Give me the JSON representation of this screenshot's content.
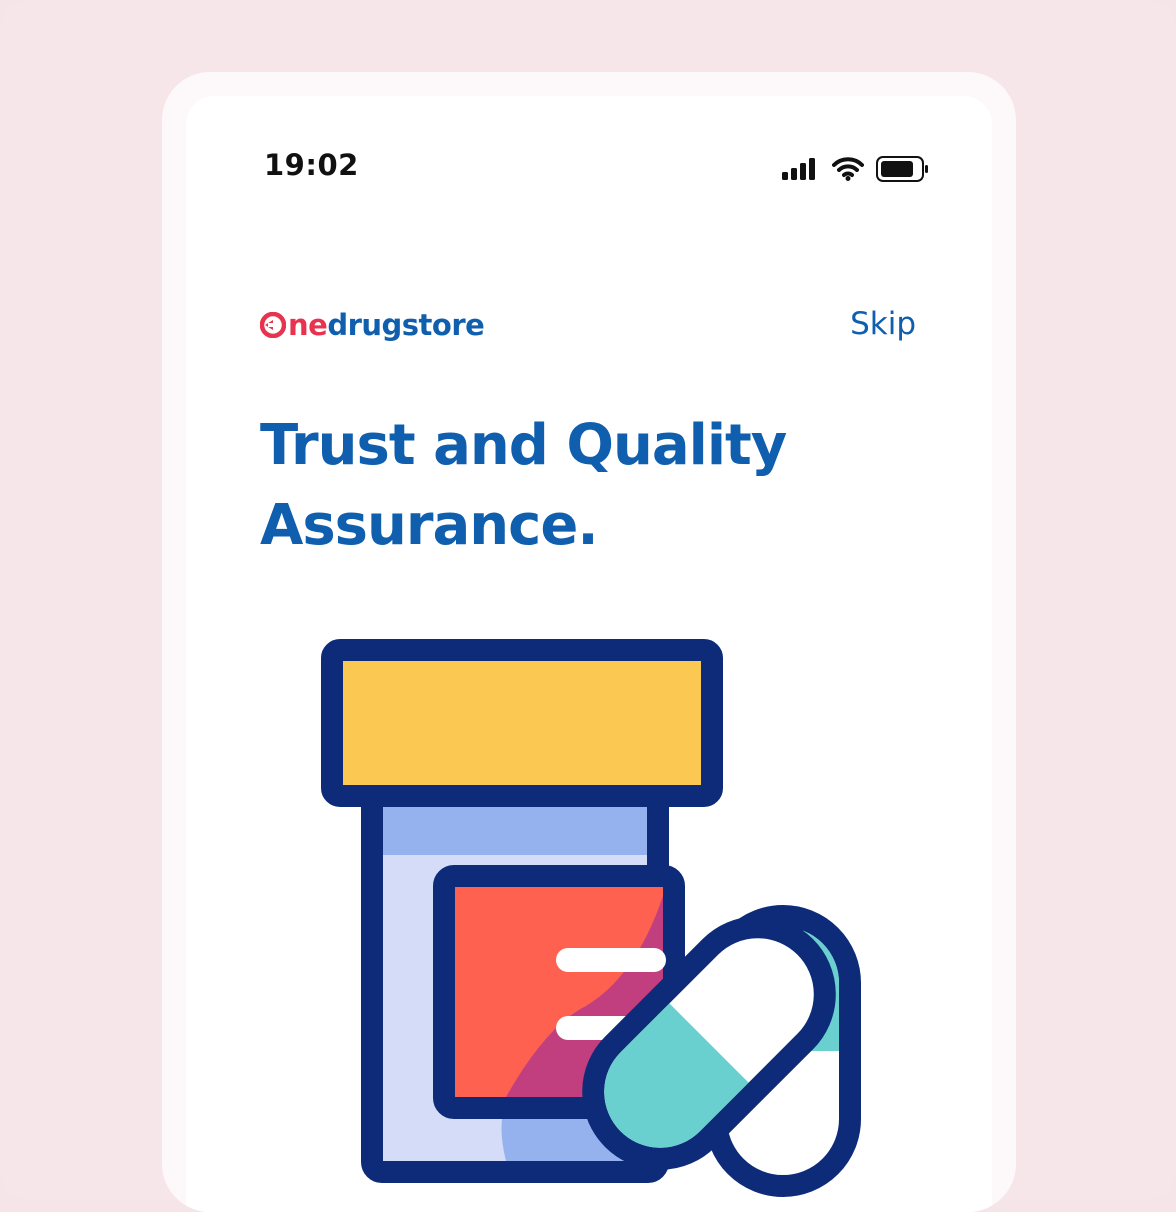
{
  "status_bar": {
    "time": "19:02"
  },
  "brand": {
    "logo_prefix": "ne",
    "logo_suffix": "drugstore"
  },
  "header": {
    "skip_label": "Skip"
  },
  "onboarding": {
    "title_line1": "Trust and Quality",
    "title_line2": "Assurance."
  },
  "colors": {
    "brand_blue": "#0f5fae",
    "brand_red": "#e8334f",
    "outline_navy": "#0d2b78",
    "cap_yellow": "#fbc952",
    "label_red": "#fe6150",
    "capsule_teal": "#6acfcf",
    "bottle_light": "#d4dcf8",
    "bottle_band": "#95b2ee"
  },
  "icons": [
    "signal-icon",
    "wifi-icon",
    "battery-icon",
    "medicine-bottle-illustration",
    "capsule-illustration"
  ]
}
